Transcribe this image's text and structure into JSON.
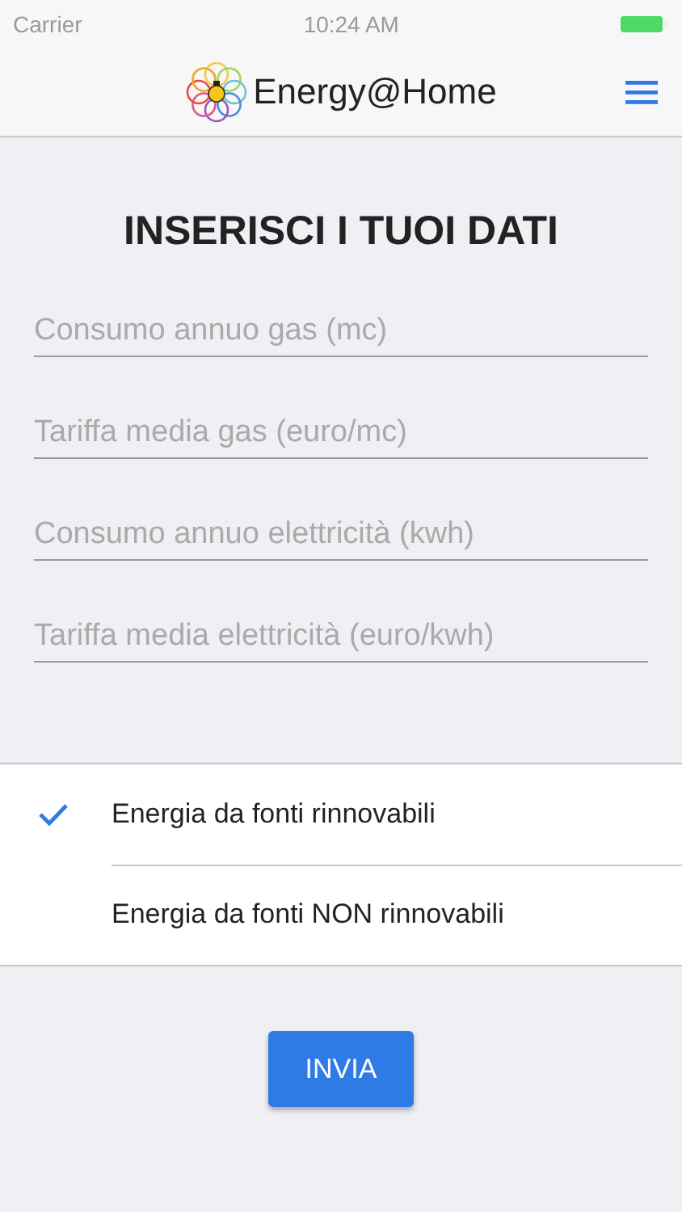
{
  "status_bar": {
    "carrier": "Carrier",
    "time": "10:24 AM"
  },
  "nav": {
    "title": "Energy@Home"
  },
  "heading": "INSERISCI I TUOI DATI",
  "fields": [
    {
      "placeholder": "Consumo annuo gas (mc)"
    },
    {
      "placeholder": "Tariffa media gas (euro/mc)"
    },
    {
      "placeholder": "Consumo annuo elettricità (kwh)"
    },
    {
      "placeholder": "Tariffa media elettricità (euro/kwh)"
    }
  ],
  "options": [
    {
      "label": "Energia da fonti rinnovabili",
      "selected": true
    },
    {
      "label": "Energia da fonti NON rinnovabili",
      "selected": false
    }
  ],
  "submit": "INVIA"
}
